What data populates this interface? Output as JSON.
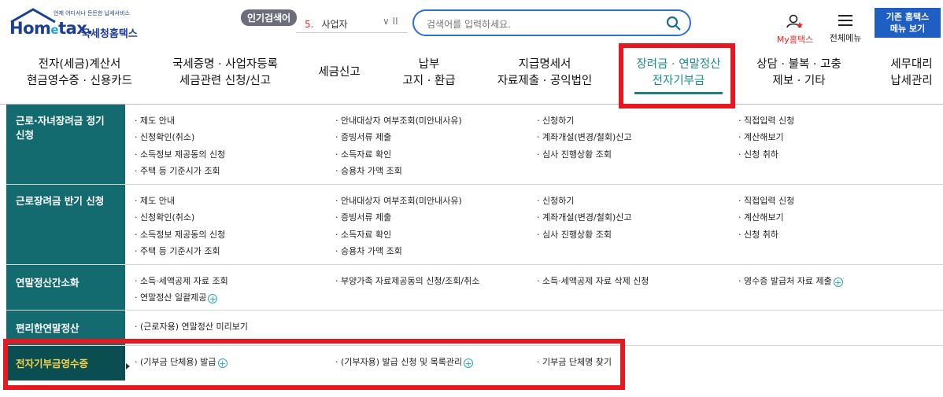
{
  "logo": {
    "text_main": "Hom",
    "text_e": "e",
    "text_end": "tax.",
    "kr": "국세청홈택스",
    "sub": "언제 어디서나 든든한 납세서비스"
  },
  "popular": {
    "badge": "인기검색어",
    "rank": "5.",
    "word": "사업자",
    "controls": "∨ II"
  },
  "search": {
    "placeholder": "검색어를 입력하세요."
  },
  "header_right": {
    "myhome": "My홈택스",
    "allmenu": "전체메뉴",
    "oldhome_line1": "기존 홈택스",
    "oldhome_line2": "메뉴 보기"
  },
  "gnb": [
    {
      "l1": "전자(세금)계산서",
      "l2": "현금영수증 · 신용카드"
    },
    {
      "l1": "국세증명 · 사업자등록",
      "l2": "세금관련 신청/신고"
    },
    {
      "l1": "세금신고",
      "l2": ""
    },
    {
      "l1": "납부",
      "l2": "고지 · 환급"
    },
    {
      "l1": "지급명세서",
      "l2": "자료제출 · 공익법인"
    },
    {
      "l1": "장려금 · 연말정산",
      "l2": "전자기부금"
    },
    {
      "l1": "상담 · 불복 · 고충",
      "l2": "제보 · 기타"
    },
    {
      "l1": "세무대리",
      "l2": "납세관리"
    }
  ],
  "sections": [
    {
      "title1": "근로·자녀장려금 정기",
      "title2": "신청",
      "links": [
        "제도 안내",
        "안내대상자 여부조회(미안내사유)",
        "신청하기",
        "직접입력 신청",
        "신청확인(취소)",
        "증빙서류 제출",
        "계좌개설(변경/철회)신고",
        "계산해보기",
        "소득정보 제공동의 신청",
        "소득자료 확인",
        "심사 진행상황 조회",
        "신청 취하",
        "주택 등 기준시가 조회",
        "승용차 가액 조회"
      ]
    },
    {
      "title1": "근로장려금 반기 신청",
      "title2": "",
      "links": [
        "제도 안내",
        "안내대상자 여부조회(미안내사유)",
        "신청하기",
        "직접입력 신청",
        "신청확인(취소)",
        "증빙서류 제출",
        "계좌개설(변경/철회)신고",
        "계산해보기",
        "소득정보 제공동의 신청",
        "소득자료 확인",
        "심사 진행상황 조회",
        "신청 취하",
        "주택 등 기준시가 조회",
        "승용차 가액 조회"
      ]
    },
    {
      "title1": "연말정산간소화",
      "title2": "",
      "links": [
        "소득·세액공제 자료 조회",
        "부양가족 자료제공동의 신청/조회/취소",
        "소득·세액공제 자료 삭제 신청",
        "영수증 발급처 자료 제출",
        "연말정산 일괄제공"
      ]
    },
    {
      "title1": "편리한연말정산",
      "title2": "",
      "links": [
        "(근로자용) 연말정산 미리보기"
      ]
    },
    {
      "title1": "전자기부금영수증",
      "title2": "",
      "links": [
        "(기부금 단체용) 발급",
        "(기부자용) 발급 신청 및 목록관리",
        "기부금 단체명 찾기"
      ]
    }
  ],
  "colors": {
    "accent_teal": "#146b6f",
    "highlight_red": "#e5191f",
    "active_text": "#f3d34a",
    "brand_blue": "#1c3f94"
  }
}
